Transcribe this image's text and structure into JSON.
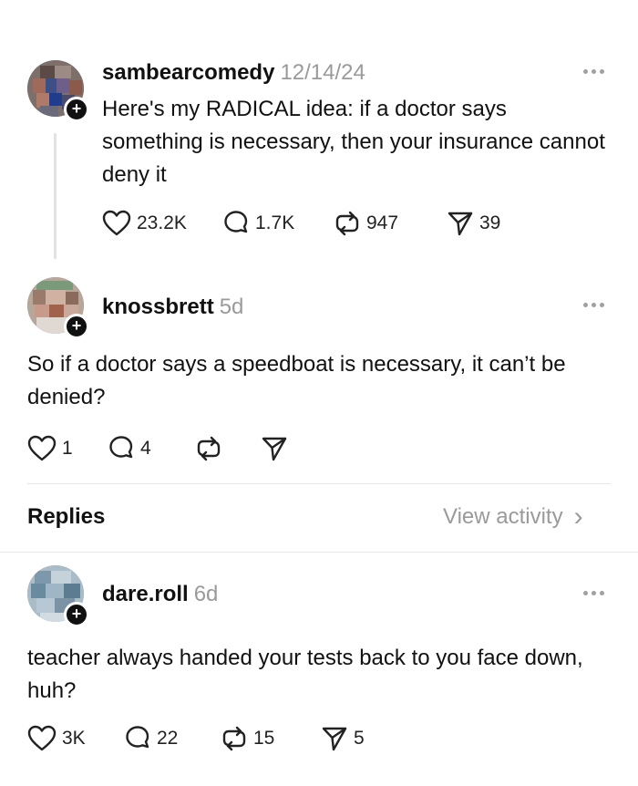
{
  "posts": [
    {
      "username": "sambearcomedy",
      "timestamp": "12/14/24",
      "text": "Here's my RADICAL idea: if a doctor says something is necessary, then your  insurance cannot deny it",
      "likes": "23.2K",
      "comments": "1.7K",
      "reposts": "947",
      "shares": "39"
    },
    {
      "username": "knossbrett",
      "timestamp": "5d",
      "text": "So if a doctor says a speedboat is necessary, it can’t be denied?",
      "likes": "1",
      "comments": "4",
      "reposts": "",
      "shares": ""
    }
  ],
  "replies_section": {
    "title": "Replies",
    "view_activity": "View activity",
    "chevron": "›"
  },
  "replies": [
    {
      "username": "dare.roll",
      "timestamp": "6d",
      "text": "teacher always handed your tests back to you face down, huh?",
      "likes": "3K",
      "comments": "22",
      "reposts": "15",
      "shares": "5"
    }
  ],
  "icons": {
    "like": "heart-icon",
    "comment": "comment-icon",
    "repost": "repost-icon",
    "share": "send-icon",
    "more": "more-icon",
    "follow": "plus-icon"
  },
  "colors": {
    "text": "#111111",
    "muted": "#9a9a9a",
    "divider": "#e6e6e6"
  }
}
